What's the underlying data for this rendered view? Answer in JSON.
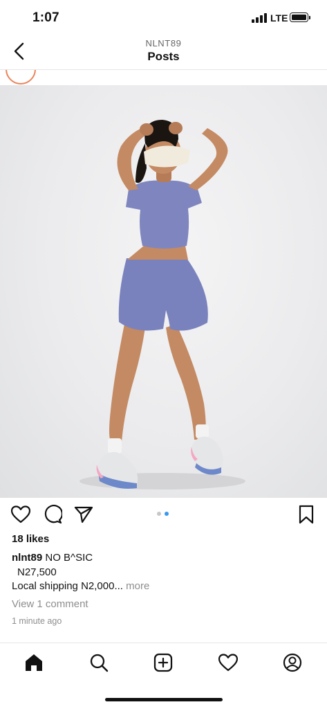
{
  "status_bar": {
    "time": "1:07",
    "network": "LTE"
  },
  "header": {
    "username": "NLNT89",
    "title": "Posts"
  },
  "post": {
    "likes": "18 likes",
    "caption_username": "nlnt89",
    "caption_text": "NO B^SIC",
    "price": "N27,500",
    "shipping": "Local shipping N2,000...",
    "more_label": "more",
    "view_comments": "View 1 comment",
    "timestamp": "1 minute ago",
    "carousel": {
      "count": 2,
      "active_index": 1
    }
  },
  "colors": {
    "text": "#111111",
    "muted": "#8e8e8e",
    "carousel_active": "#3897f0",
    "carousel_inactive": "#c7c7c7",
    "story_ring": "#e9855b",
    "outfit": "#7a82bd"
  },
  "icons": {
    "back": "chevron-left-icon",
    "like": "heart-icon",
    "comment": "comment-bubble-icon",
    "share": "paper-plane-icon",
    "save": "bookmark-icon",
    "home": "home-icon",
    "search": "search-icon",
    "create": "plus-square-icon",
    "activity": "heart-icon",
    "profile": "profile-icon"
  }
}
